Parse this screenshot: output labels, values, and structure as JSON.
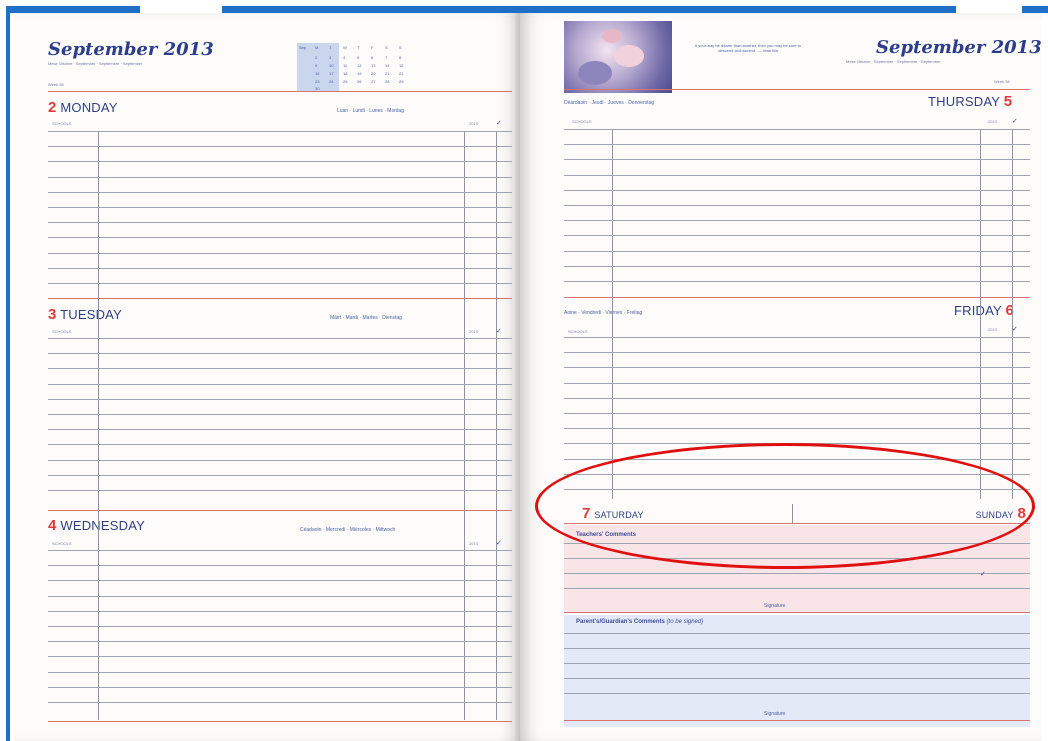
{
  "colors": {
    "frame": "#1e6fc8",
    "ink": "#2f3f86",
    "day_number": "#e23a3a",
    "highlight_oval": "#e00f10"
  },
  "left_page": {
    "month_title": "September 2013",
    "month_sub": "Mese Ottobre · September · Septiembre · September",
    "week": "Week 36",
    "days": [
      {
        "num": "2",
        "name": "MONDAY",
        "langs": "Luan · Lundi · Lunes · Montag",
        "sub": "SCHOOLS",
        "col": "2013"
      },
      {
        "num": "3",
        "name": "TUESDAY",
        "langs": "Máirt · Mardi · Martes · Dienstag",
        "sub": "SCHOOLS",
        "col": "2013"
      },
      {
        "num": "4",
        "name": "WEDNESDAY",
        "langs": "Céadaoin · Mercredi · Miércoles · Mittwoch",
        "sub": "SCHOOLS",
        "col": "2013"
      }
    ]
  },
  "right_page": {
    "month_title": "September 2013",
    "month_sub": "Mese Ottobre · September · Septiembre · September",
    "week": "Week 36",
    "quote": "If your way be dearer than another, then you may be sure to descend and ascend. — Jean Ma",
    "days": [
      {
        "num": "5",
        "name": "THURSDAY",
        "langs": "Déardaoin · Jeudi · Jueves · Donnerstag",
        "sub": "SCHOOLS",
        "col": "2013"
      },
      {
        "num": "6",
        "name": "FRIDAY",
        "langs": "Aoine · Vendredi · Viernes · Freitag",
        "sub": "SCHOOLS",
        "col": "2013"
      }
    ],
    "weekend": {
      "sat_num": "7",
      "sat_name": "SATURDAY",
      "sun_name": "SUNDAY",
      "sun_num": "8",
      "teacher_comments": "Teachers' Comments",
      "parent_comments": "Parent's/Guardian's Comments",
      "parent_note": "(to be signed)",
      "signature": "Signature"
    }
  }
}
